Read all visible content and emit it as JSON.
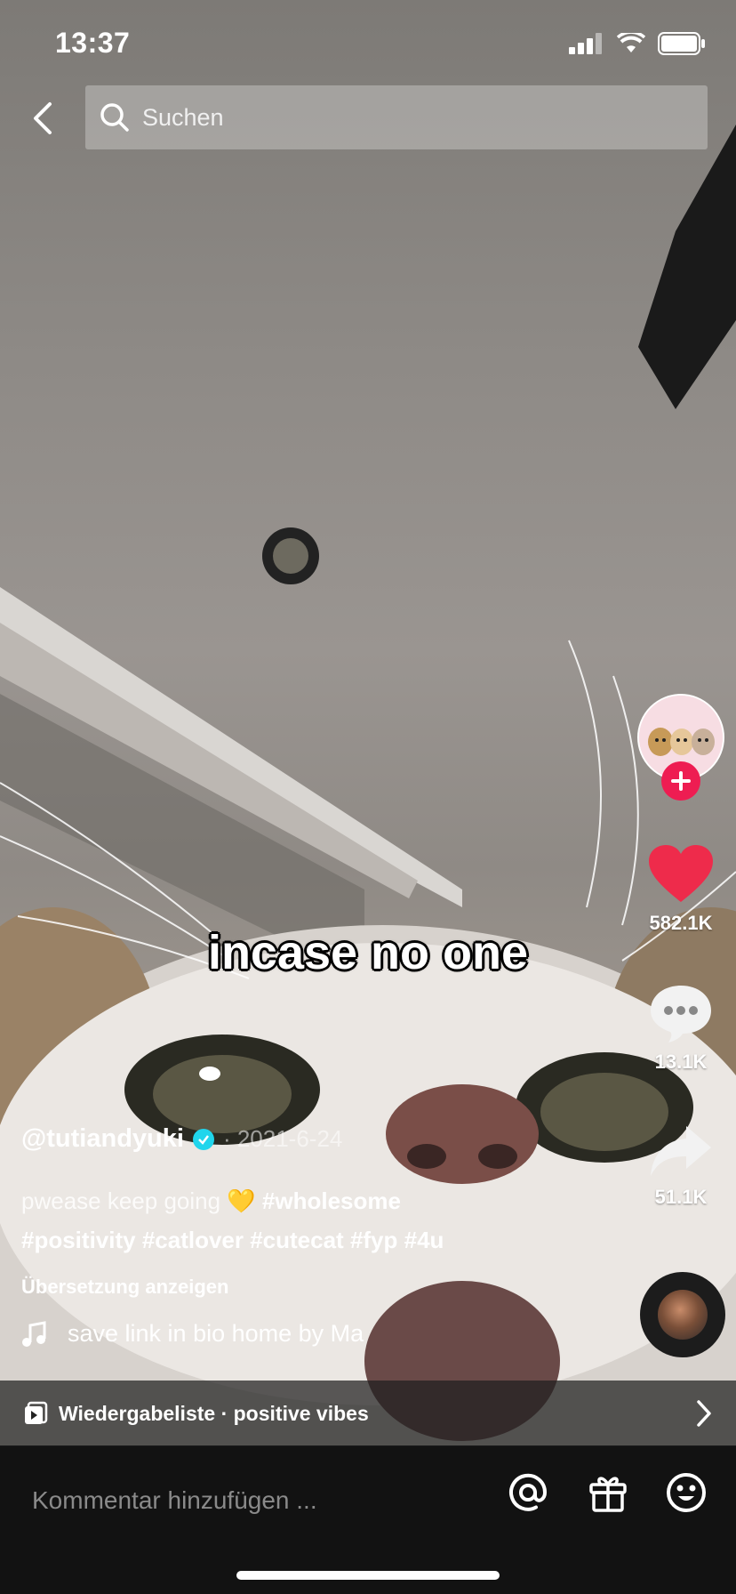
{
  "status": {
    "time": "13:37"
  },
  "search": {
    "placeholder": "Suchen"
  },
  "video": {
    "overlay_text": "incase no one"
  },
  "creator": {
    "username": "@tutiandyuki",
    "date": "· 2021-6-24"
  },
  "caption": {
    "text": "pwease keep going",
    "emoji": "💛",
    "line1_tag": "#wholesome",
    "line2_tags": "#positivity #catlover #cutecat #fyp #4u"
  },
  "translate_label": "Übersetzung anzeigen",
  "sound": {
    "label": "save link in bio home by Ma"
  },
  "actions": {
    "likes": "582.1K",
    "comments": "13.1K",
    "shares": "51.1K"
  },
  "playlist": {
    "label": "Wiedergabeliste · positive vibes"
  },
  "comment": {
    "placeholder": "Kommentar hinzufügen ..."
  },
  "colors": {
    "like": "#ee2b4b",
    "follow": "#ee1d52",
    "verified": "#20d5ec"
  },
  "icons": [
    "back-icon",
    "search-icon",
    "heart-icon",
    "comment-icon",
    "share-icon",
    "music-note-icon",
    "playlist-icon",
    "chevron-right-icon",
    "at-icon",
    "gift-icon",
    "emoji-icon"
  ]
}
